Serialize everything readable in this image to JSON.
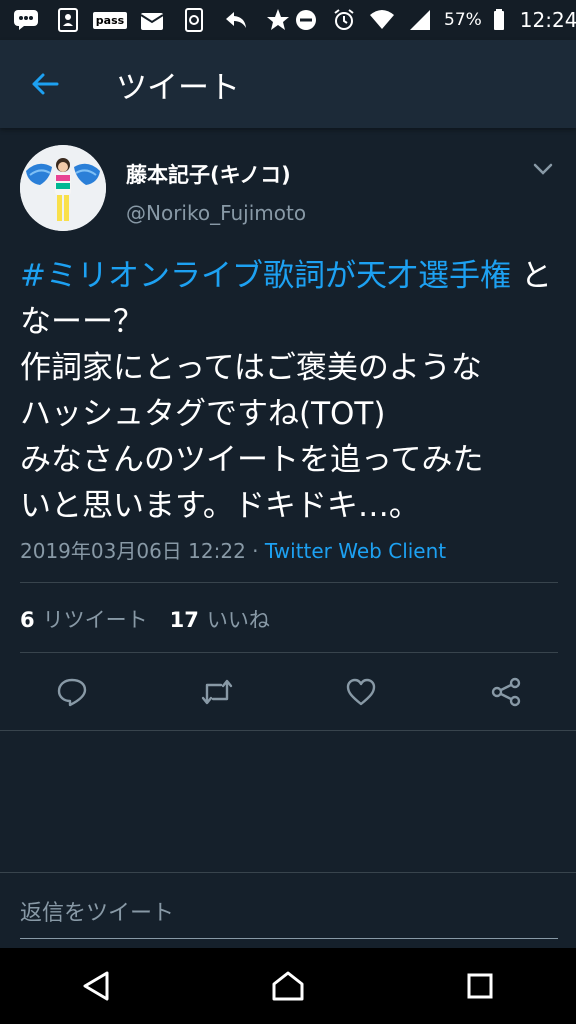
{
  "status_bar": {
    "battery_percent": "57%",
    "time": "12:24",
    "pass_label": "pass"
  },
  "header": {
    "title": "ツイート"
  },
  "tweet": {
    "author_name": "藤本記子(キノコ)",
    "author_handle": "@Noriko_Fujimoto",
    "hashtag": "#ミリオンライブ歌詞が天才選手権",
    "body_rest": " となーー？\n作詞家にとってはご褒美のような\nハッシュタグですね(TOT)\nみなさんのツイートを追ってみた\nいと思います。ドキドキ…。",
    "timestamp": "2019年03月06日 12:22",
    "separator": " · ",
    "client": "Twitter Web Client"
  },
  "stats": {
    "retweet_count": "6",
    "retweet_label": "リツイート",
    "like_count": "17",
    "like_label": "いいね"
  },
  "reply": {
    "placeholder": "返信をツイート"
  },
  "colors": {
    "background": "#15202b",
    "header": "#1c2a38",
    "accent": "#1da1f2",
    "secondary_text": "#8899a6"
  }
}
